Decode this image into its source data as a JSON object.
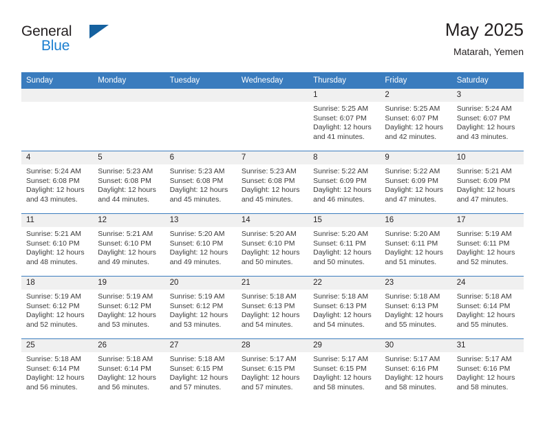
{
  "brand": {
    "name_part1": "General",
    "name_part2": "Blue",
    "logo_icon": "triangle-logo-icon"
  },
  "header": {
    "title": "May 2025",
    "subtitle": "Matarah, Yemen"
  },
  "colors": {
    "header_blue": "#3a7cbe",
    "brand_blue": "#1c7fd0",
    "logo_blue": "#15619f",
    "daynum_band": "#f0f0f0",
    "text": "#231f20"
  },
  "calendar": {
    "weekday_headers": [
      "Sunday",
      "Monday",
      "Tuesday",
      "Wednesday",
      "Thursday",
      "Friday",
      "Saturday"
    ],
    "weeks": [
      [
        {
          "day": "",
          "sunrise": "",
          "sunset": "",
          "daylight_line1": "",
          "daylight_line2": "",
          "empty": true
        },
        {
          "day": "",
          "sunrise": "",
          "sunset": "",
          "daylight_line1": "",
          "daylight_line2": "",
          "empty": true
        },
        {
          "day": "",
          "sunrise": "",
          "sunset": "",
          "daylight_line1": "",
          "daylight_line2": "",
          "empty": true
        },
        {
          "day": "",
          "sunrise": "",
          "sunset": "",
          "daylight_line1": "",
          "daylight_line2": "",
          "empty": true
        },
        {
          "day": "1",
          "sunrise": "Sunrise: 5:25 AM",
          "sunset": "Sunset: 6:07 PM",
          "daylight_line1": "Daylight: 12 hours",
          "daylight_line2": "and 41 minutes.",
          "empty": false
        },
        {
          "day": "2",
          "sunrise": "Sunrise: 5:25 AM",
          "sunset": "Sunset: 6:07 PM",
          "daylight_line1": "Daylight: 12 hours",
          "daylight_line2": "and 42 minutes.",
          "empty": false
        },
        {
          "day": "3",
          "sunrise": "Sunrise: 5:24 AM",
          "sunset": "Sunset: 6:07 PM",
          "daylight_line1": "Daylight: 12 hours",
          "daylight_line2": "and 43 minutes.",
          "empty": false
        }
      ],
      [
        {
          "day": "4",
          "sunrise": "Sunrise: 5:24 AM",
          "sunset": "Sunset: 6:08 PM",
          "daylight_line1": "Daylight: 12 hours",
          "daylight_line2": "and 43 minutes.",
          "empty": false
        },
        {
          "day": "5",
          "sunrise": "Sunrise: 5:23 AM",
          "sunset": "Sunset: 6:08 PM",
          "daylight_line1": "Daylight: 12 hours",
          "daylight_line2": "and 44 minutes.",
          "empty": false
        },
        {
          "day": "6",
          "sunrise": "Sunrise: 5:23 AM",
          "sunset": "Sunset: 6:08 PM",
          "daylight_line1": "Daylight: 12 hours",
          "daylight_line2": "and 45 minutes.",
          "empty": false
        },
        {
          "day": "7",
          "sunrise": "Sunrise: 5:23 AM",
          "sunset": "Sunset: 6:08 PM",
          "daylight_line1": "Daylight: 12 hours",
          "daylight_line2": "and 45 minutes.",
          "empty": false
        },
        {
          "day": "8",
          "sunrise": "Sunrise: 5:22 AM",
          "sunset": "Sunset: 6:09 PM",
          "daylight_line1": "Daylight: 12 hours",
          "daylight_line2": "and 46 minutes.",
          "empty": false
        },
        {
          "day": "9",
          "sunrise": "Sunrise: 5:22 AM",
          "sunset": "Sunset: 6:09 PM",
          "daylight_line1": "Daylight: 12 hours",
          "daylight_line2": "and 47 minutes.",
          "empty": false
        },
        {
          "day": "10",
          "sunrise": "Sunrise: 5:21 AM",
          "sunset": "Sunset: 6:09 PM",
          "daylight_line1": "Daylight: 12 hours",
          "daylight_line2": "and 47 minutes.",
          "empty": false
        }
      ],
      [
        {
          "day": "11",
          "sunrise": "Sunrise: 5:21 AM",
          "sunset": "Sunset: 6:10 PM",
          "daylight_line1": "Daylight: 12 hours",
          "daylight_line2": "and 48 minutes.",
          "empty": false
        },
        {
          "day": "12",
          "sunrise": "Sunrise: 5:21 AM",
          "sunset": "Sunset: 6:10 PM",
          "daylight_line1": "Daylight: 12 hours",
          "daylight_line2": "and 49 minutes.",
          "empty": false
        },
        {
          "day": "13",
          "sunrise": "Sunrise: 5:20 AM",
          "sunset": "Sunset: 6:10 PM",
          "daylight_line1": "Daylight: 12 hours",
          "daylight_line2": "and 49 minutes.",
          "empty": false
        },
        {
          "day": "14",
          "sunrise": "Sunrise: 5:20 AM",
          "sunset": "Sunset: 6:10 PM",
          "daylight_line1": "Daylight: 12 hours",
          "daylight_line2": "and 50 minutes.",
          "empty": false
        },
        {
          "day": "15",
          "sunrise": "Sunrise: 5:20 AM",
          "sunset": "Sunset: 6:11 PM",
          "daylight_line1": "Daylight: 12 hours",
          "daylight_line2": "and 50 minutes.",
          "empty": false
        },
        {
          "day": "16",
          "sunrise": "Sunrise: 5:20 AM",
          "sunset": "Sunset: 6:11 PM",
          "daylight_line1": "Daylight: 12 hours",
          "daylight_line2": "and 51 minutes.",
          "empty": false
        },
        {
          "day": "17",
          "sunrise": "Sunrise: 5:19 AM",
          "sunset": "Sunset: 6:11 PM",
          "daylight_line1": "Daylight: 12 hours",
          "daylight_line2": "and 52 minutes.",
          "empty": false
        }
      ],
      [
        {
          "day": "18",
          "sunrise": "Sunrise: 5:19 AM",
          "sunset": "Sunset: 6:12 PM",
          "daylight_line1": "Daylight: 12 hours",
          "daylight_line2": "and 52 minutes.",
          "empty": false
        },
        {
          "day": "19",
          "sunrise": "Sunrise: 5:19 AM",
          "sunset": "Sunset: 6:12 PM",
          "daylight_line1": "Daylight: 12 hours",
          "daylight_line2": "and 53 minutes.",
          "empty": false
        },
        {
          "day": "20",
          "sunrise": "Sunrise: 5:19 AM",
          "sunset": "Sunset: 6:12 PM",
          "daylight_line1": "Daylight: 12 hours",
          "daylight_line2": "and 53 minutes.",
          "empty": false
        },
        {
          "day": "21",
          "sunrise": "Sunrise: 5:18 AM",
          "sunset": "Sunset: 6:13 PM",
          "daylight_line1": "Daylight: 12 hours",
          "daylight_line2": "and 54 minutes.",
          "empty": false
        },
        {
          "day": "22",
          "sunrise": "Sunrise: 5:18 AM",
          "sunset": "Sunset: 6:13 PM",
          "daylight_line1": "Daylight: 12 hours",
          "daylight_line2": "and 54 minutes.",
          "empty": false
        },
        {
          "day": "23",
          "sunrise": "Sunrise: 5:18 AM",
          "sunset": "Sunset: 6:13 PM",
          "daylight_line1": "Daylight: 12 hours",
          "daylight_line2": "and 55 minutes.",
          "empty": false
        },
        {
          "day": "24",
          "sunrise": "Sunrise: 5:18 AM",
          "sunset": "Sunset: 6:14 PM",
          "daylight_line1": "Daylight: 12 hours",
          "daylight_line2": "and 55 minutes.",
          "empty": false
        }
      ],
      [
        {
          "day": "25",
          "sunrise": "Sunrise: 5:18 AM",
          "sunset": "Sunset: 6:14 PM",
          "daylight_line1": "Daylight: 12 hours",
          "daylight_line2": "and 56 minutes.",
          "empty": false
        },
        {
          "day": "26",
          "sunrise": "Sunrise: 5:18 AM",
          "sunset": "Sunset: 6:14 PM",
          "daylight_line1": "Daylight: 12 hours",
          "daylight_line2": "and 56 minutes.",
          "empty": false
        },
        {
          "day": "27",
          "sunrise": "Sunrise: 5:18 AM",
          "sunset": "Sunset: 6:15 PM",
          "daylight_line1": "Daylight: 12 hours",
          "daylight_line2": "and 57 minutes.",
          "empty": false
        },
        {
          "day": "28",
          "sunrise": "Sunrise: 5:17 AM",
          "sunset": "Sunset: 6:15 PM",
          "daylight_line1": "Daylight: 12 hours",
          "daylight_line2": "and 57 minutes.",
          "empty": false
        },
        {
          "day": "29",
          "sunrise": "Sunrise: 5:17 AM",
          "sunset": "Sunset: 6:15 PM",
          "daylight_line1": "Daylight: 12 hours",
          "daylight_line2": "and 58 minutes.",
          "empty": false
        },
        {
          "day": "30",
          "sunrise": "Sunrise: 5:17 AM",
          "sunset": "Sunset: 6:16 PM",
          "daylight_line1": "Daylight: 12 hours",
          "daylight_line2": "and 58 minutes.",
          "empty": false
        },
        {
          "day": "31",
          "sunrise": "Sunrise: 5:17 AM",
          "sunset": "Sunset: 6:16 PM",
          "daylight_line1": "Daylight: 12 hours",
          "daylight_line2": "and 58 minutes.",
          "empty": false
        }
      ]
    ]
  }
}
